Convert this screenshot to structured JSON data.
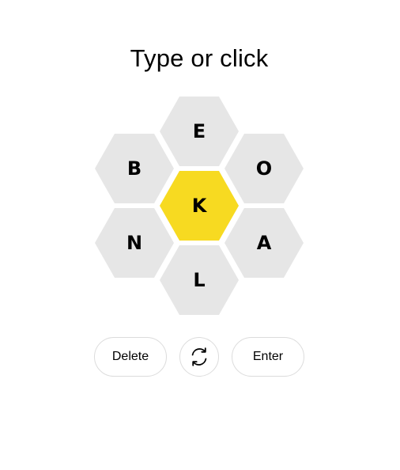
{
  "prompt": "Type or click",
  "hive": {
    "center": "K",
    "top": "E",
    "upper_left": "B",
    "upper_right": "O",
    "lower_left": "N",
    "lower_right": "A",
    "bottom": "L"
  },
  "controls": {
    "delete_label": "Delete",
    "shuffle_icon": "shuffle-icon",
    "enter_label": "Enter"
  },
  "colors": {
    "center_hex": "#f7da21",
    "outer_hex": "#e6e6e6",
    "button_border": "#dcdcdc"
  }
}
